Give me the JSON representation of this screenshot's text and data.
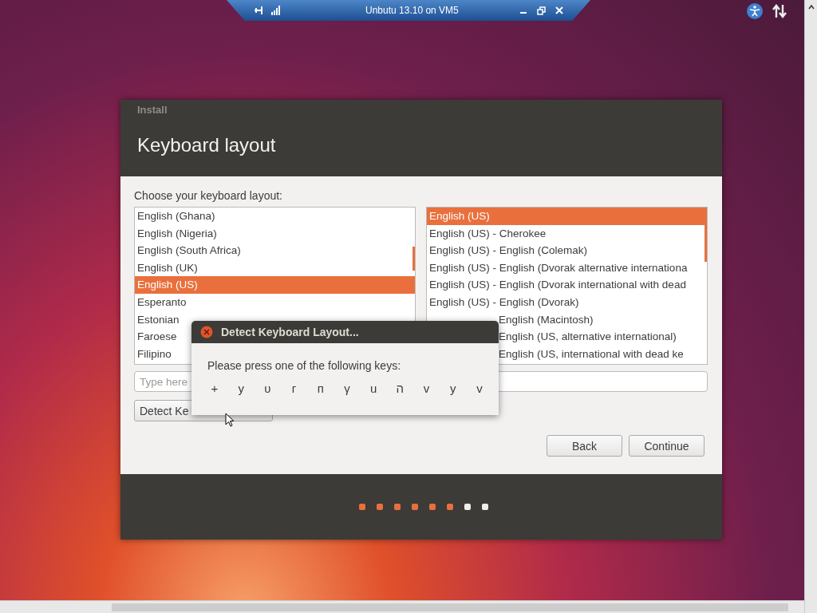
{
  "vm_bar": {
    "title": "Unbutu 13.10 on VM5"
  },
  "window": {
    "header": "Install",
    "title": "Keyboard layout"
  },
  "prompt": "Choose your keyboard layout:",
  "layouts": [
    {
      "text": "English (Ghana)",
      "selected": false
    },
    {
      "text": "English (Nigeria)",
      "selected": false
    },
    {
      "text": "English (South Africa)",
      "selected": false
    },
    {
      "text": "English (UK)",
      "selected": false
    },
    {
      "text": "English (US)",
      "selected": true
    },
    {
      "text": "Esperanto",
      "selected": false
    },
    {
      "text": "Estonian",
      "selected": false
    },
    {
      "text": "Faroese",
      "selected": false
    },
    {
      "text": "Filipino",
      "selected": false
    }
  ],
  "variants": [
    {
      "text": "English (US)",
      "selected": true,
      "kind": "full"
    },
    {
      "text": "English (US) - Cherokee",
      "selected": false,
      "kind": "full"
    },
    {
      "text": "English (US) - English (Colemak)",
      "selected": false,
      "kind": "full"
    },
    {
      "text": "English (US) - English (Dvorak alternative internationa",
      "selected": false,
      "kind": "full"
    },
    {
      "text": "English (US) - English (Dvorak international with dead",
      "selected": false,
      "kind": "full"
    },
    {
      "text": "English (US) - English (Dvorak)",
      "selected": false,
      "kind": "full"
    },
    {
      "text": "English (Macintosh)",
      "selected": false,
      "kind": "covered"
    },
    {
      "text": "English (US, alternative international)",
      "selected": false,
      "kind": "covered"
    },
    {
      "text": "English (US, international with dead ke",
      "selected": false,
      "kind": "covered"
    }
  ],
  "test_field": {
    "placeholder": "Type here"
  },
  "detect_button": "Detect Ke",
  "buttons": [
    "Back",
    "Continue"
  ],
  "progress": [
    {
      "done": true
    },
    {
      "done": true
    },
    {
      "done": true
    },
    {
      "done": true
    },
    {
      "done": true
    },
    {
      "done": true
    },
    {
      "done": false
    },
    {
      "done": false
    }
  ],
  "dialog": {
    "title": "Detect Keyboard Layout...",
    "message": "Please press one of the following keys:",
    "keys": [
      "+",
      "y",
      "υ",
      "г",
      "п",
      "γ",
      "u",
      "ה",
      "v",
      "у",
      "v"
    ]
  }
}
